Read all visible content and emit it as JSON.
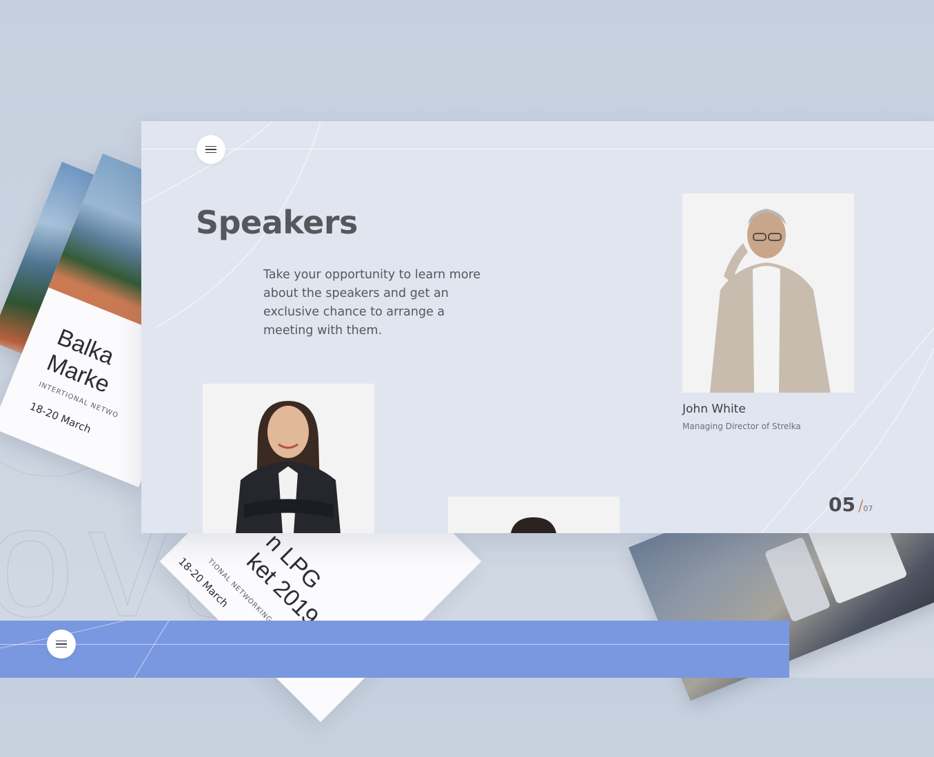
{
  "background": {
    "letters": "ovaro",
    "color": "#c9d2df"
  },
  "card_left": {
    "title_line1": "Balka",
    "title_line2": "Marke",
    "subtitle": "INTERTIONAL NETWO",
    "date": "18-20 March"
  },
  "card_bottom": {
    "title_line1": "n LPG",
    "title_line2": "ket 2019",
    "subtitle": "TIONAL NETWORKING CONFEREN",
    "date": "18-20 March"
  },
  "slide": {
    "title": "Speakers",
    "intro": "Take your opportunity to learn more about the speakers and get an exclusive chance to arrange a meeting with them.",
    "speaker": {
      "name": "John White",
      "role": "Managing Director of Strelka"
    },
    "counter": {
      "current": "05",
      "separator": "/",
      "total": "07"
    },
    "accent": "#d0855a",
    "bg": "#e1e5ef"
  },
  "menu_icon": "hamburger-icon",
  "bottom_slide": {
    "color": "#7a98e0"
  }
}
